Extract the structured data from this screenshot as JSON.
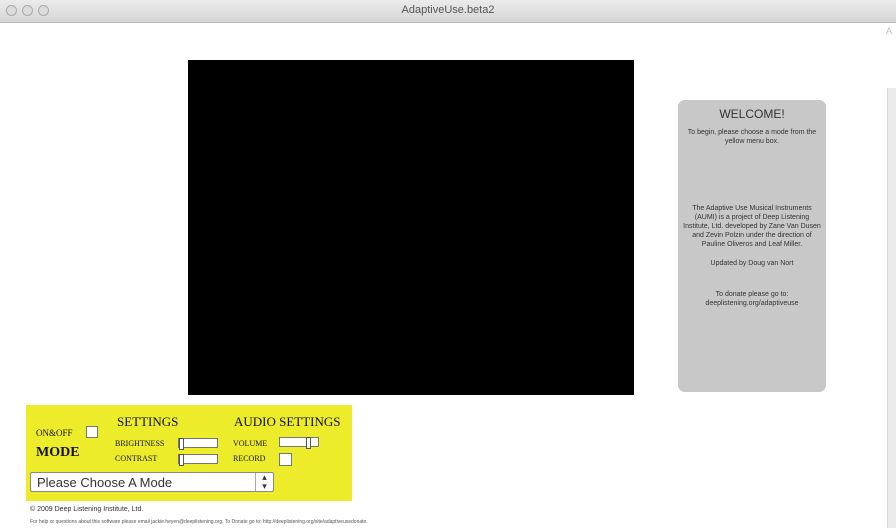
{
  "window": {
    "title": "AdaptiveUse.beta2",
    "corner_mark": "A"
  },
  "welcome": {
    "title": "WELCOME!",
    "intro": "To begin, please choose a mode from the yellow menu box.",
    "about": "The Adaptive Use Musical Instruments (AUMI) is a project of Deep Listening Institute, Ltd. developed by Zane Van Dusen and Zevin Polzin under the direction of Pauline Oliveros and Leaf Miller.",
    "updated": "Updated by Doug van Nort",
    "donate": "To donate please go to: deeplistening.org/adaptiveuse"
  },
  "controls": {
    "onoff_label": "ON&OFF",
    "mode_label": "MODE",
    "settings_label": "SETTINGS",
    "brightness_label": "BRIGHTNESS",
    "contrast_label": "CONTRAST",
    "audio_settings_label": "AUDIO SETTINGS",
    "volume_label": "VOLUME",
    "record_label": "RECORD",
    "mode_select_value": "Please Choose A Mode",
    "brightness_value": 0.0,
    "contrast_value": 0.0,
    "volume_value": 0.8,
    "onoff_checked": false,
    "record_checked": false,
    "panel_color": "#ecec2a"
  },
  "footer": {
    "copyright": "© 2009 Deep Listening Institute, Ltd.",
    "help": "For help or questions about this software please email jackie.heyen@deeplistening.org. To Donate go to: http://deeplistening.org/site/adaptiveusedonate."
  }
}
